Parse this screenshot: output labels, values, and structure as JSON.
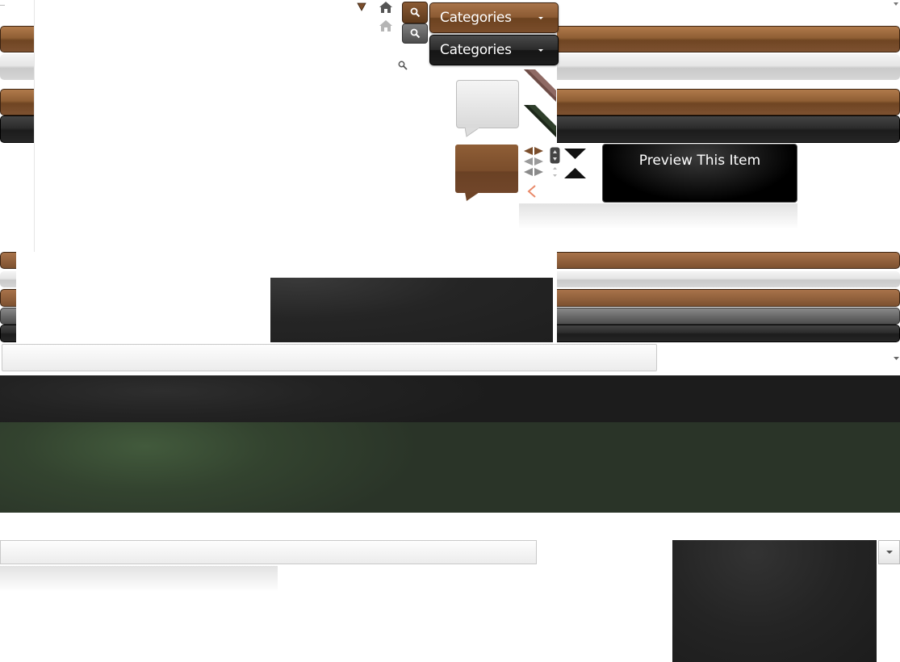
{
  "dropdowns": [
    {
      "label": "Categories",
      "style": "brown"
    },
    {
      "label": "Categories",
      "style": "black"
    }
  ],
  "preview": {
    "label": "Preview This Item"
  },
  "colors": {
    "brown": "#8b5a32",
    "black": "#1b1b1b",
    "silver": "#dcdcdc",
    "green": "#2f3b2c",
    "grey": "#666666"
  },
  "icons": [
    "home-icon",
    "search-icon",
    "triangle-down-icon",
    "caret-down-icon",
    "arrow-left-icon",
    "arrow-right-icon",
    "spinner-icon",
    "chevron-up-icon",
    "chevron-down-icon"
  ]
}
